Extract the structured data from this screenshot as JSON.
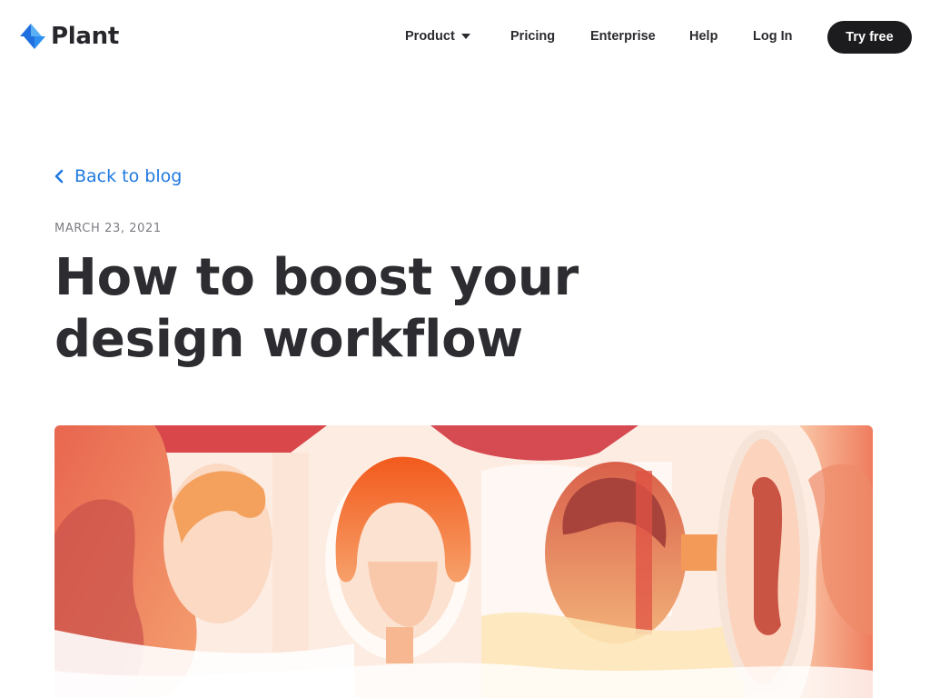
{
  "brand": {
    "name": "Plant",
    "logo_icon": "plant-logo-icon",
    "accent": "#1f7ae0"
  },
  "nav": {
    "product": "Product",
    "pricing": "Pricing",
    "enterprise": "Enterprise",
    "help": "Help",
    "login": "Log In",
    "cta": "Try free"
  },
  "article": {
    "back_label": "Back to blog",
    "date": "MARCH 23, 2021",
    "title": "How to boost your design workflow",
    "hero_image": "illustration-of-faces-in-orange-red-tones"
  },
  "colors": {
    "text": "#2d2d31",
    "link": "#1f7ae0",
    "button_bg": "#1c1c1e",
    "hero_orange": "#f08a5a",
    "hero_red": "#d84a4a"
  }
}
